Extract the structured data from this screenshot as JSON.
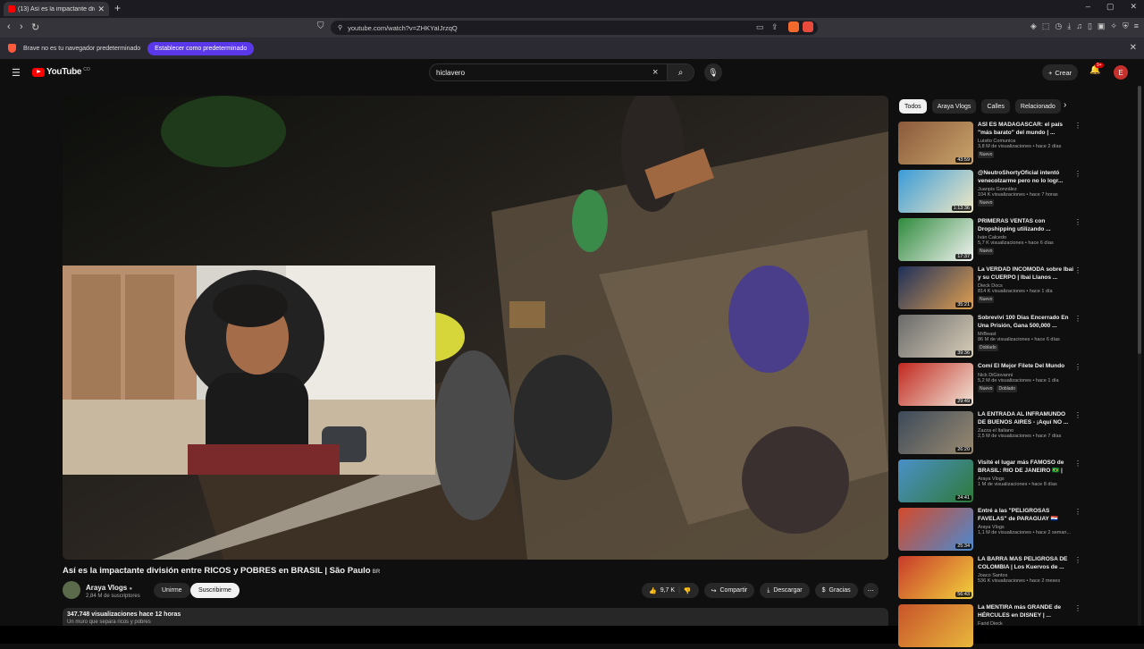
{
  "browser": {
    "tab_title": "(13) Así es la impactante divi",
    "new_tab": "+",
    "url": "youtube.com/watch?v=ZHKYaIJrzqQ",
    "window_controls": [
      "–",
      "▢",
      "✕"
    ],
    "infobar_message": "Brave no es tu navegador predeterminado",
    "infobar_button": "Establecer como predeterminado"
  },
  "header": {
    "logo_text": "YouTube",
    "logo_country": "CO",
    "search_value": "hiclavero",
    "create_label": "Crear",
    "notifications_badge": "9+",
    "avatar_letter": "E"
  },
  "video": {
    "title": "Así es la impactante división entre RICOS y POBRES en BRASIL | São Paulo",
    "title_flag": "BR",
    "channel": "Araya Vlogs",
    "subscribers": "2,84 M de suscriptores",
    "join_label": "Unirme",
    "subscribe_label": "Suscribirme",
    "likes": "9,7 K",
    "share_label": "Compartir",
    "download_label": "Descargar",
    "thanks_label": "Gracias",
    "views_line": "347.748 visualizaciones  hace 12 horas",
    "desc_more": "Un muro que separa ricos y pobres"
  },
  "sidebar": {
    "chips": [
      "Todos",
      "Araya Vlogs",
      "Calles",
      "Relacionado"
    ],
    "recs": [
      {
        "title": "ASÍ ES MADAGASCAR: el país \"más barato\" del mundo | ...",
        "channel": "Luisito Comunica",
        "meta": "3,8 M de visualizaciones • hace 2 días",
        "duration": "43:59",
        "tags": [
          "Nuevo"
        ],
        "color1": "#8b5a3c",
        "color2": "#c9a46a"
      },
      {
        "title": "@NeutroShortyOficial intentó venecolzarme pero no lo logr...",
        "channel": "Juanpis González",
        "meta": "104 K visualizaciones • hace 7 horas",
        "duration": "1:13:36",
        "tags": [
          "Nuevo"
        ],
        "color1": "#3a9bd8",
        "color2": "#f2e9c4"
      },
      {
        "title": "PRIMERAS VENTAS con Dropshipping utilizando ...",
        "channel": "Iván Calcedo",
        "meta": "5,7 K visualizaciones • hace 6 días",
        "duration": "17:37",
        "tags": [
          "Nuevo"
        ],
        "color1": "#2f8a3c",
        "color2": "#f4f4f4"
      },
      {
        "title": "La VERDAD INCÓMODA sobre Ibai y su CUERPO | Ibai Llanos ...",
        "channel": "Dieck Docs",
        "meta": "814 K visualizaciones • hace 1 día",
        "duration": "35:21",
        "tags": [
          "Nuevo"
        ],
        "color1": "#1d2f5a",
        "color2": "#e0a050"
      },
      {
        "title": "Sobreviví 100 Días Encerrado En Una Prisión, Gana 500,000 ...",
        "channel": "MrBeast",
        "meta": "86 M de visualizaciones • hace 6 días",
        "duration": "39:36",
        "tags": [
          "Doblado"
        ],
        "color1": "#6a6a6a",
        "color2": "#d8cdb8"
      },
      {
        "title": "Comí El Mejor Filete Del Mundo",
        "channel": "Nick DiGiovanni",
        "meta": "5,2 M de visualizaciones • hace 1 día",
        "duration": "29:49",
        "tags": [
          "Nuevo",
          "Doblado"
        ],
        "color1": "#c2281f",
        "color2": "#f0e6d8"
      },
      {
        "title": "LA ENTRADA AL INFRAMUNDO DE BUENOS AIRES - ¡Aquí NO ...",
        "channel": "Zazza el Italiano",
        "meta": "2,5 M de visualizaciones • hace 7 días",
        "duration": "26:20",
        "tags": [],
        "color1": "#3c4a5a",
        "color2": "#9a8a70"
      },
      {
        "title": "Visité el lugar más FAMOSO de BRASIL: RIO DE JANEIRO 🇧🇷 |",
        "channel": "Araya Vlogs",
        "meta": "1 M de visualizaciones • hace 8 días",
        "duration": "24:41",
        "tags": [],
        "color1": "#4a90c8",
        "color2": "#2f7a3a"
      },
      {
        "title": "Entré a las \"PELIGROSAS FAVELAS\" de PARAGUAY 🇵🇾",
        "channel": "Araya Vlogs",
        "meta": "1,1 M de visualizaciones • hace 2 seman...",
        "duration": "25:34",
        "tags": [],
        "color1": "#d44a2a",
        "color2": "#4a8ad0"
      },
      {
        "title": "LA BARRA MAS PELIGROSA DE COLOMBIA | Los Kuervos de ...",
        "channel": "Joaco Santos",
        "meta": "536 K visualizaciones • hace 2 meses",
        "duration": "56:43",
        "tags": [],
        "color1": "#c83a2a",
        "color2": "#f2d23c"
      },
      {
        "title": "La MENTIRA más GRANDE de HÉRCULES en DISNEY | ...",
        "channel": "Farid Dieck",
        "meta": "",
        "duration": "",
        "tags": [],
        "color1": "#c8532a",
        "color2": "#e8b83c"
      }
    ]
  }
}
